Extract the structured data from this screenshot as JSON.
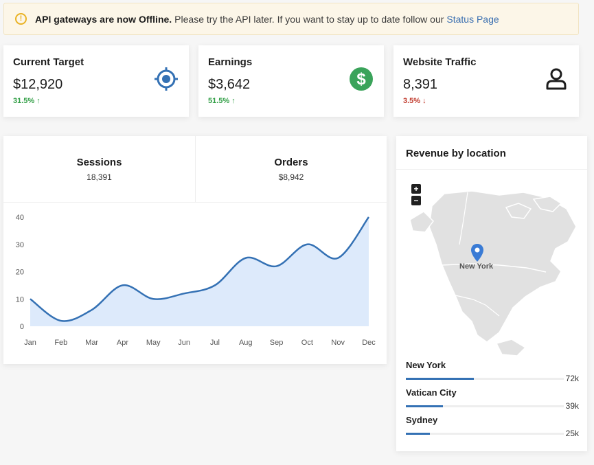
{
  "alert": {
    "bold_text": "API gateways are now Offline.",
    "text": "Please try the API later. If you want to stay up to date follow our",
    "link_text": "Status Page",
    "icon": "warning-circle-icon",
    "color": "#e9b224"
  },
  "stats": [
    {
      "title": "Current Target",
      "value": "$12,920",
      "delta": "31.5%",
      "direction": "up",
      "icon": "target-icon",
      "icon_color": "#3471b4"
    },
    {
      "title": "Earnings",
      "value": "$3,642",
      "delta": "51.5%",
      "direction": "up",
      "icon": "dollar-circle-icon",
      "icon_color": "#3aa35a"
    },
    {
      "title": "Website Traffic",
      "value": "8,391",
      "delta": "3.5%",
      "direction": "down",
      "icon": "user-icon",
      "icon_color": "#1d1d1d"
    }
  ],
  "sessions": {
    "tabs": [
      {
        "label": "Sessions",
        "value": "18,391"
      },
      {
        "label": "Orders",
        "value": "$8,942"
      }
    ]
  },
  "chart_data": {
    "type": "area",
    "categories": [
      "Jan",
      "Feb",
      "Mar",
      "Apr",
      "May",
      "Jun",
      "Jul",
      "Aug",
      "Sep",
      "Oct",
      "Nov",
      "Dec"
    ],
    "values": [
      10,
      2,
      6,
      15,
      10,
      12,
      15,
      25,
      22,
      30,
      25,
      40
    ],
    "ylim": [
      0,
      40
    ],
    "yticks": [
      0,
      10,
      20,
      30,
      40
    ],
    "grid": false,
    "line_color": "#3471b4",
    "fill_color": "#ddeafb"
  },
  "map": {
    "title": "Revenue by location",
    "zoom_in": "+",
    "zoom_out": "−",
    "marker_label": "New York",
    "marker_icon": "map-pin-icon",
    "marker_color": "#3a7bd5"
  },
  "locations": [
    {
      "name": "New York",
      "value": "72k",
      "fraction": 0.72
    },
    {
      "name": "Vatican City",
      "value": "39k",
      "fraction": 0.39
    },
    {
      "name": "Sydney",
      "value": "25k",
      "fraction": 0.25
    }
  ],
  "colors": {
    "accent": "#3471b4",
    "up": "#2f9e44",
    "down": "#c0392b"
  }
}
